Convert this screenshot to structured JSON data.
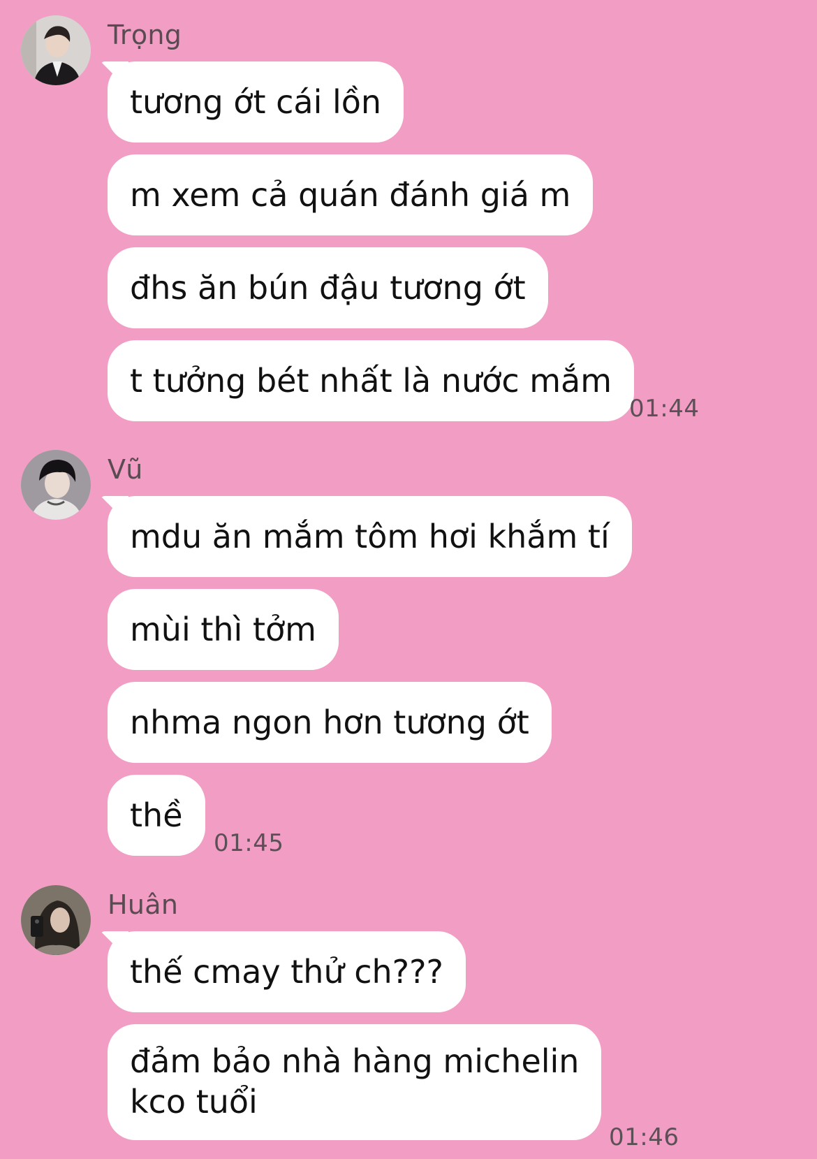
{
  "conversation": {
    "groups": [
      {
        "sender": "Trọng",
        "messages": [
          "tương ớt cái lồn",
          "m xem cả quán đánh giá m",
          "đhs ăn bún đậu tương ớt",
          "t tưởng bét nhất là nước mắm"
        ],
        "time": "01:44"
      },
      {
        "sender": "Vũ",
        "messages": [
          "mdu ăn mắm tôm hơi khắm tí",
          "mùi thì tởm",
          "nhma ngon hơn tương ớt",
          "thề"
        ],
        "time": "01:45"
      },
      {
        "sender": "Huân",
        "messages": [
          "thế cmay thử ch???",
          "đảm bảo nhà hàng michelin",
          "kco tuổi"
        ],
        "time": "01:46"
      }
    ]
  },
  "colors": {
    "background": "#f29dc4",
    "bubble": "#ffffff",
    "sender_text": "#5a4b52",
    "time_text": "#5c5057"
  },
  "icons": {
    "avatar_trong": "avatar-photo",
    "avatar_vu": "avatar-photo",
    "avatar_huan": "avatar-photo"
  }
}
